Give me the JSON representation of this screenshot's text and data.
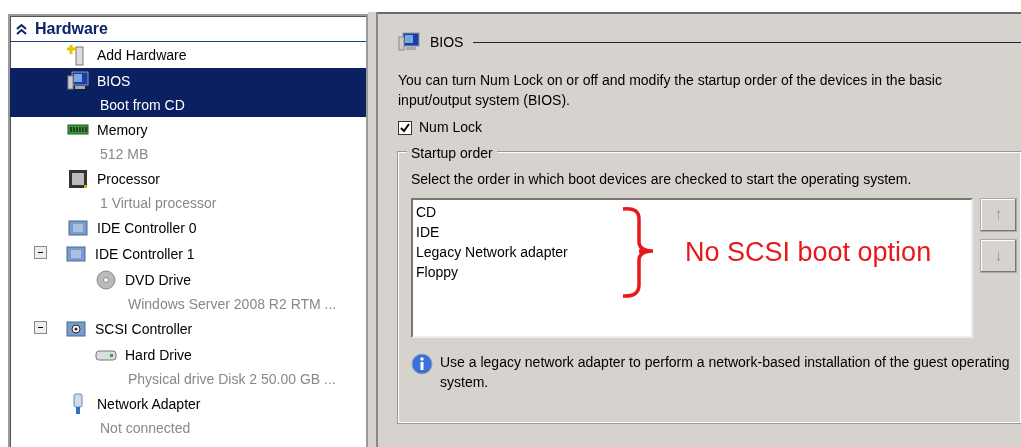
{
  "sidebar": {
    "section": {
      "title": "Hardware",
      "expanded": true
    },
    "items": [
      {
        "kind": "add",
        "name": "Add Hardware",
        "selected": false
      },
      {
        "kind": "bios",
        "name": "BIOS",
        "detail": "Boot from CD",
        "selected": true
      },
      {
        "kind": "memory",
        "name": "Memory",
        "detail": "512 MB",
        "selected": false
      },
      {
        "kind": "processor",
        "name": "Processor",
        "detail": "1 Virtual processor",
        "selected": false
      },
      {
        "kind": "controller",
        "name": "IDE Controller 0",
        "selected": false
      },
      {
        "kind": "controller",
        "name": "IDE Controller 1",
        "selected": false,
        "expanded": true,
        "children": [
          {
            "kind": "dvd",
            "name": "DVD Drive",
            "detail": "Windows Server 2008 R2 RTM ...",
            "selected": false
          }
        ]
      },
      {
        "kind": "scsi",
        "name": "SCSI Controller",
        "selected": false,
        "expanded": true,
        "children": [
          {
            "kind": "disk",
            "name": "Hard Drive",
            "detail": "Physical drive Disk 2 50.00 GB ...",
            "selected": false
          }
        ]
      },
      {
        "kind": "network",
        "name": "Network Adapter",
        "detail": "Not connected",
        "selected": false
      }
    ]
  },
  "panel": {
    "title": "BIOS",
    "description": "You can turn Num Lock on or off and modify the startup order of the devices in the basic input/output system (BIOS).",
    "num_lock": {
      "label": "Num Lock",
      "checked": true
    },
    "startup_order": {
      "title": "Startup order",
      "instruction": "Select the order in which boot devices are checked to start the operating system.",
      "devices": [
        "CD",
        "IDE",
        "Legacy Network adapter",
        "Floppy"
      ],
      "move_buttons": [
        {
          "label": "↑",
          "disabled": true
        },
        {
          "label": "↓",
          "disabled": true
        }
      ],
      "annotation": "No SCSI boot option",
      "note": "Use a legacy network adapter to perform a network-based installation of the guest operating system."
    }
  }
}
